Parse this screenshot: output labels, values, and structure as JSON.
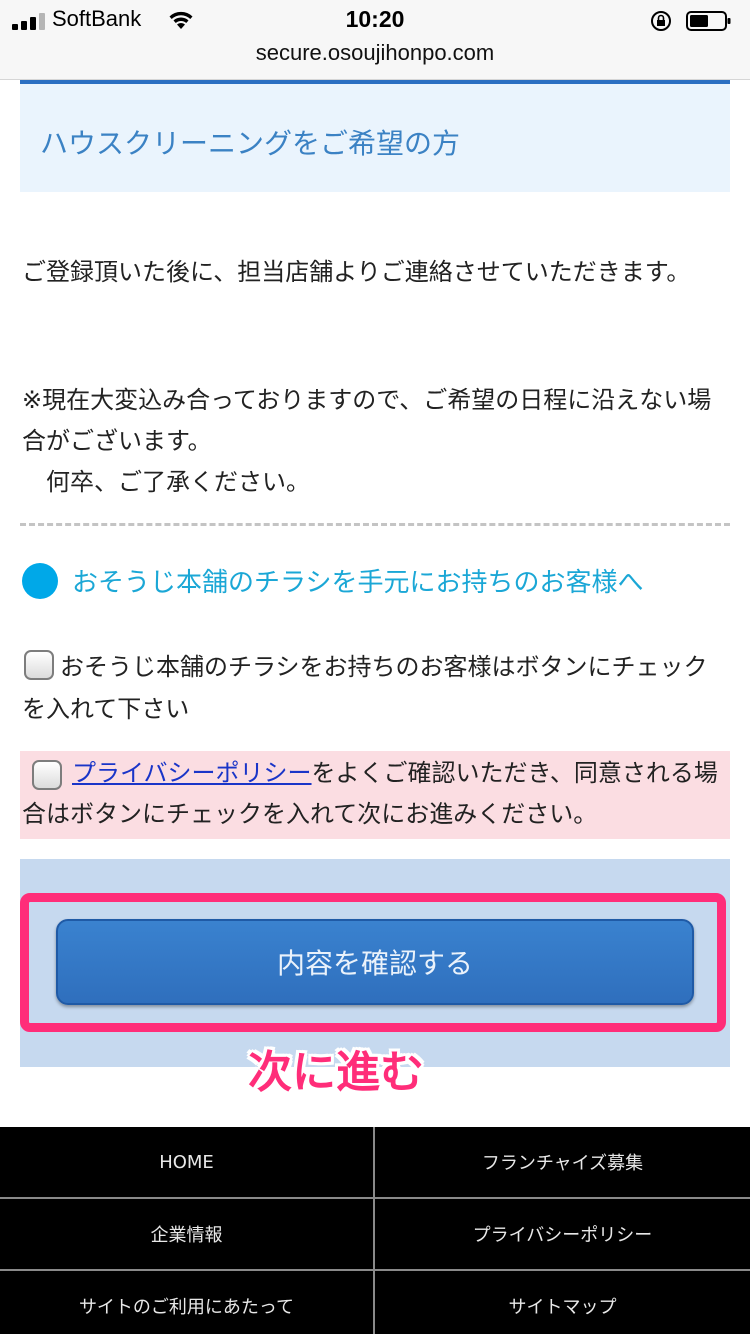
{
  "status_bar": {
    "carrier": "SoftBank",
    "time": "10:20",
    "url": "secure.osoujihonpo.com"
  },
  "notice": {
    "title": "ハウスクリーニングをご希望の方"
  },
  "content": {
    "paragraph1": "ご登録頂いた後に、担当店舗よりご連絡させていただきます。",
    "paragraph2_line1": "※現在大変込み合っておりますので、ご希望の日程に沿えない場合がございます。",
    "paragraph2_line2": "何卒、ご了承ください。"
  },
  "flyer_section": {
    "heading": "おそうじ本舗のチラシを手元にお持ちのお客様へ",
    "checkbox_label": "おそうじ本舗のチラシをお持ちのお客様はボタンにチェックを入れて下さい",
    "checked": false
  },
  "privacy": {
    "link_text": "プライバシーポリシー",
    "text_after_link": "をよくご確認いただき、同意される場合はボタンにチェックを入れて次にお進みください。",
    "checked": false
  },
  "confirm": {
    "button_label": "内容を確認する",
    "annotation": "次に進む"
  },
  "footer": {
    "links": [
      "HOME",
      "フランチャイズ募集",
      "企業情報",
      "プライバシーポリシー",
      "サイトのご利用にあたって",
      "サイトマップ"
    ]
  },
  "colors": {
    "accent_blue": "#2f6fbd",
    "highlight_pink": "#ff2d79",
    "section_cyan": "#00a8e8",
    "privacy_bg": "#fbdde2"
  },
  "icons": [
    "signal-icon",
    "wifi-icon",
    "rotation-lock-icon",
    "battery-icon",
    "bullet-dot-icon",
    "checkbox-icon"
  ]
}
